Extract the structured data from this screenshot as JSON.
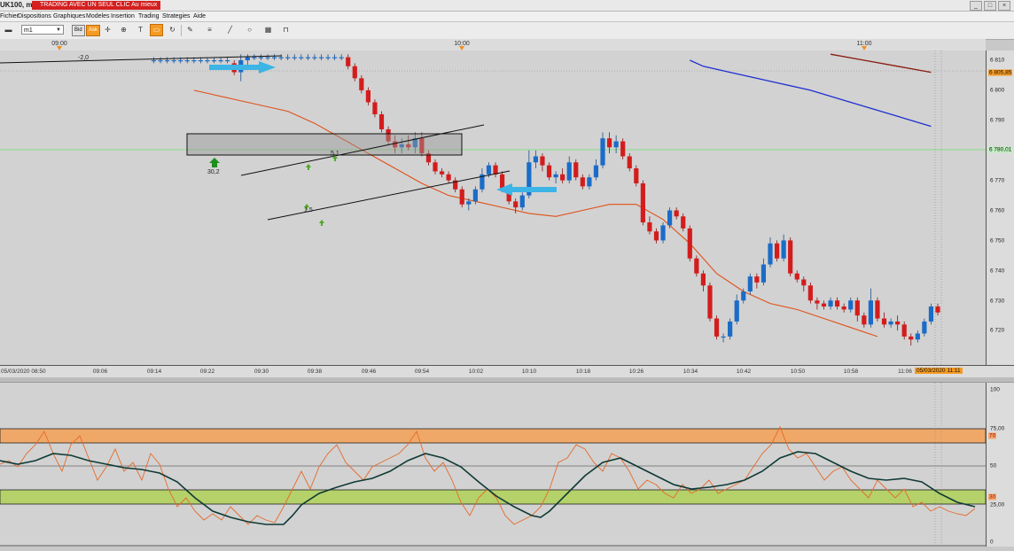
{
  "window": {
    "title": "UK100, m1",
    "promo": "TRADING AVEC UN SEUL CLIC Au mieux",
    "controls": [
      "_",
      "□",
      "×"
    ]
  },
  "menu": [
    "Fichier",
    "Dispositions",
    "Graphiques",
    "Modeles",
    "Insertion",
    "Trading",
    "Strategies",
    "Aide"
  ],
  "toolbar": {
    "timeframe": "m1",
    "bid_label": "Bid",
    "ask_label": "Ask",
    "icons": [
      "chart-type-icon",
      "crosshair-icon",
      "zoom-icon",
      "text-icon",
      "comment-icon",
      "refresh-icon",
      "pencil-icon",
      "lines-icon",
      "trendline-icon",
      "circle-icon",
      "layout-icon",
      "magnet-icon"
    ]
  },
  "top_time_axis": [
    "09:00",
    "10:00",
    "11:00"
  ],
  "bottom_time_axis": {
    "start": "05/03/2020 08:50",
    "ticks": [
      "09:06",
      "09:14",
      "09:22",
      "09:30",
      "09:38",
      "09:46",
      "09:54",
      "10:02",
      "10:10",
      "10:18",
      "10:26",
      "10:34",
      "10:42",
      "10:50",
      "10:58",
      "11:06"
    ],
    "end": "05/03/2020 11:11"
  },
  "price_axis": {
    "ticks": [
      "6 810",
      "6 800",
      "6 790",
      "6 770",
      "6 760",
      "6 750",
      "6 740",
      "6 730",
      "6 720"
    ],
    "badge_current": "6 805,85",
    "badge_level": "6 780,01"
  },
  "annotations": {
    "label_top_left": "-2,0",
    "label_signal": "30,2",
    "label_ch1": "5,1",
    "label_ch2": "1,5"
  },
  "oscillator_axis": {
    "ticks": [
      "100",
      "75,00",
      "50",
      "25,00",
      "0"
    ],
    "badge_70": "70",
    "badge_30": "30"
  },
  "chart_data": {
    "type": "candlestick",
    "symbol": "UK100",
    "timeframe": "m1",
    "x_range": [
      "05/03/2020 08:50",
      "05/03/2020 11:11"
    ],
    "y_range": [
      6714,
      6812
    ],
    "start_minute": 554,
    "end_minute": 671,
    "candles": [
      [
        554,
        6810,
        6811,
        6809,
        6810
      ],
      [
        555,
        6810,
        6811,
        6809,
        6810
      ],
      [
        556,
        6810,
        6811,
        6809,
        6810
      ],
      [
        557,
        6810,
        6811,
        6809,
        6810
      ],
      [
        558,
        6810,
        6811,
        6809,
        6810
      ],
      [
        559,
        6810,
        6811,
        6809,
        6810
      ],
      [
        560,
        6810,
        6811,
        6809,
        6810
      ],
      [
        561,
        6810,
        6811,
        6809,
        6810
      ],
      [
        562,
        6810,
        6811,
        6809,
        6810
      ],
      [
        563,
        6810,
        6811,
        6809,
        6810
      ],
      [
        564,
        6810,
        6811,
        6809,
        6810
      ],
      [
        565,
        6810,
        6811,
        6809,
        6810
      ],
      [
        566,
        6809,
        6810,
        6805,
        6806
      ],
      [
        567,
        6806,
        6812,
        6803,
        6810
      ],
      [
        568,
        6810,
        6812,
        6808,
        6811
      ],
      [
        569,
        6811,
        6812,
        6810,
        6811
      ],
      [
        570,
        6811,
        6812,
        6810,
        6811
      ],
      [
        571,
        6811,
        6812,
        6810,
        6811
      ],
      [
        572,
        6811,
        6812,
        6810,
        6811
      ],
      [
        573,
        6811,
        6812,
        6810,
        6811
      ],
      [
        574,
        6811,
        6812,
        6810,
        6811
      ],
      [
        575,
        6811,
        6812,
        6810,
        6811
      ],
      [
        576,
        6811,
        6812,
        6810,
        6811
      ],
      [
        577,
        6811,
        6812,
        6810,
        6811
      ],
      [
        578,
        6811,
        6812,
        6810,
        6811
      ],
      [
        579,
        6811,
        6812,
        6810,
        6811
      ],
      [
        580,
        6811,
        6812,
        6810,
        6811
      ],
      [
        581,
        6811,
        6812,
        6810,
        6811
      ],
      [
        582,
        6811,
        6812,
        6810,
        6811
      ],
      [
        583,
        6811,
        6812,
        6807,
        6808
      ],
      [
        584,
        6808,
        6809,
        6803,
        6804
      ],
      [
        585,
        6804,
        6805,
        6799,
        6800
      ],
      [
        586,
        6800,
        6801,
        6795,
        6796
      ],
      [
        587,
        6796,
        6797,
        6791,
        6792
      ],
      [
        588,
        6792,
        6793,
        6786,
        6787
      ],
      [
        589,
        6787,
        6788,
        6782,
        6783
      ],
      [
        590,
        6783,
        6785,
        6779,
        6781
      ],
      [
        591,
        6781,
        6784,
        6779,
        6782
      ],
      [
        592,
        6782,
        6785,
        6780,
        6781
      ],
      [
        593,
        6781,
        6786,
        6779,
        6784
      ],
      [
        594,
        6784,
        6786,
        6778,
        6779
      ],
      [
        595,
        6779,
        6780,
        6775,
        6776
      ],
      [
        596,
        6776,
        6777,
        6772,
        6773
      ],
      [
        597,
        6773,
        6774,
        6771,
        6772
      ],
      [
        598,
        6772,
        6773,
        6769,
        6770
      ],
      [
        599,
        6770,
        6771,
        6766,
        6767
      ],
      [
        600,
        6767,
        6768,
        6761,
        6762
      ],
      [
        601,
        6762,
        6764,
        6760,
        6763
      ],
      [
        602,
        6763,
        6768,
        6762,
        6767
      ],
      [
        603,
        6767,
        6774,
        6766,
        6772
      ],
      [
        604,
        6772,
        6776,
        6771,
        6775
      ],
      [
        605,
        6775,
        6776,
        6771,
        6772
      ],
      [
        606,
        6772,
        6773,
        6766,
        6767
      ],
      [
        607,
        6767,
        6768,
        6762,
        6763
      ],
      [
        608,
        6763,
        6764,
        6759,
        6761
      ],
      [
        609,
        6761,
        6766,
        6760,
        6765
      ],
      [
        610,
        6765,
        6780,
        6764,
        6776
      ],
      [
        611,
        6776,
        6780,
        6774,
        6778
      ],
      [
        612,
        6778,
        6779,
        6773,
        6775
      ],
      [
        613,
        6775,
        6776,
        6770,
        6771
      ],
      [
        614,
        6771,
        6773,
        6769,
        6772
      ],
      [
        615,
        6772,
        6774,
        6769,
        6770
      ],
      [
        616,
        6770,
        6778,
        6769,
        6776
      ],
      [
        617,
        6776,
        6777,
        6770,
        6771
      ],
      [
        618,
        6771,
        6772,
        6767,
        6768
      ],
      [
        619,
        6768,
        6772,
        6767,
        6771
      ],
      [
        620,
        6771,
        6777,
        6770,
        6775
      ],
      [
        621,
        6775,
        6786,
        6774,
        6784
      ],
      [
        622,
        6784,
        6786,
        6779,
        6781
      ],
      [
        623,
        6781,
        6785,
        6779,
        6783
      ],
      [
        624,
        6783,
        6784,
        6777,
        6778
      ],
      [
        625,
        6778,
        6779,
        6773,
        6774
      ],
      [
        626,
        6774,
        6775,
        6768,
        6769
      ],
      [
        627,
        6769,
        6770,
        6755,
        6756
      ],
      [
        628,
        6756,
        6758,
        6752,
        6753
      ],
      [
        629,
        6753,
        6754,
        6749,
        6750
      ],
      [
        630,
        6750,
        6756,
        6749,
        6755
      ],
      [
        631,
        6755,
        6761,
        6754,
        6760
      ],
      [
        632,
        6760,
        6761,
        6757,
        6758
      ],
      [
        633,
        6758,
        6759,
        6753,
        6754
      ],
      [
        634,
        6754,
        6755,
        6743,
        6744
      ],
      [
        635,
        6744,
        6745,
        6738,
        6739
      ],
      [
        636,
        6739,
        6740,
        6733,
        6735
      ],
      [
        637,
        6735,
        6736,
        6723,
        6724
      ],
      [
        638,
        6724,
        6725,
        6717,
        6718
      ],
      [
        639,
        6718,
        6719,
        6716,
        6718
      ],
      [
        640,
        6718,
        6724,
        6717,
        6723
      ],
      [
        641,
        6723,
        6732,
        6722,
        6730
      ],
      [
        642,
        6730,
        6734,
        6729,
        6733
      ],
      [
        643,
        6733,
        6739,
        6732,
        6738
      ],
      [
        644,
        6738,
        6739,
        6734,
        6736
      ],
      [
        645,
        6736,
        6744,
        6735,
        6742
      ],
      [
        646,
        6742,
        6751,
        6741,
        6749
      ],
      [
        647,
        6749,
        6750,
        6743,
        6744
      ],
      [
        648,
        6744,
        6752,
        6743,
        6750
      ],
      [
        649,
        6750,
        6751,
        6738,
        6739
      ],
      [
        650,
        6739,
        6740,
        6736,
        6737
      ],
      [
        651,
        6737,
        6738,
        6733,
        6735
      ],
      [
        652,
        6735,
        6736,
        6729,
        6730
      ],
      [
        653,
        6730,
        6731,
        6727,
        6729
      ],
      [
        654,
        6729,
        6730,
        6727,
        6728
      ],
      [
        655,
        6728,
        6731,
        6727,
        6730
      ],
      [
        656,
        6730,
        6731,
        6727,
        6728
      ],
      [
        657,
        6728,
        6729,
        6726,
        6727
      ],
      [
        658,
        6727,
        6731,
        6726,
        6730
      ],
      [
        659,
        6730,
        6731,
        6723,
        6725
      ],
      [
        660,
        6725,
        6726,
        6721,
        6722
      ],
      [
        661,
        6722,
        6734,
        6721,
        6730
      ],
      [
        662,
        6730,
        6731,
        6723,
        6724
      ],
      [
        663,
        6724,
        6726,
        6721,
        6722
      ],
      [
        664,
        6722,
        6724,
        6721,
        6723
      ],
      [
        665,
        6723,
        6725,
        6720,
        6722
      ],
      [
        666,
        6722,
        6723,
        6717,
        6718
      ],
      [
        667,
        6718,
        6719,
        6715,
        6717
      ],
      [
        668,
        6717,
        6720,
        6716,
        6719
      ],
      [
        669,
        6719,
        6724,
        6718,
        6723
      ],
      [
        670,
        6723,
        6729,
        6722,
        6728
      ],
      [
        671,
        6728,
        6729,
        6725,
        6726
      ]
    ],
    "overlays": {
      "blue_line": [
        [
          634,
          6810
        ],
        [
          636,
          6808
        ],
        [
          640,
          6806
        ],
        [
          646,
          6803
        ],
        [
          652,
          6800
        ],
        [
          658,
          6796
        ],
        [
          664,
          6792
        ],
        [
          670,
          6788
        ]
      ],
      "dark_red_line": [
        [
          655,
          6812
        ],
        [
          660,
          6810
        ],
        [
          665,
          6808
        ],
        [
          670,
          6806
        ]
      ],
      "orange_line": [
        [
          560,
          6800
        ],
        [
          566,
          6797
        ],
        [
          570,
          6795
        ],
        [
          574,
          6793
        ],
        [
          578,
          6789
        ],
        [
          582,
          6784
        ],
        [
          586,
          6779
        ],
        [
          590,
          6774
        ],
        [
          594,
          6769
        ],
        [
          598,
          6765
        ],
        [
          602,
          6763
        ],
        [
          606,
          6761
        ],
        [
          610,
          6759
        ],
        [
          614,
          6758
        ],
        [
          618,
          6760
        ],
        [
          622,
          6762
        ],
        [
          626,
          6762
        ],
        [
          630,
          6757
        ],
        [
          634,
          6749
        ],
        [
          638,
          6739
        ],
        [
          642,
          6733
        ],
        [
          646,
          6729
        ],
        [
          650,
          6727
        ],
        [
          654,
          6724
        ],
        [
          658,
          6721
        ],
        [
          662,
          6718
        ]
      ]
    },
    "oscillator": {
      "y_range": [
        0,
        100
      ],
      "bands": {
        "upper": [
          70,
          75
        ],
        "lower": [
          25,
          30
        ]
      },
      "levels": [
        50
      ]
    }
  }
}
